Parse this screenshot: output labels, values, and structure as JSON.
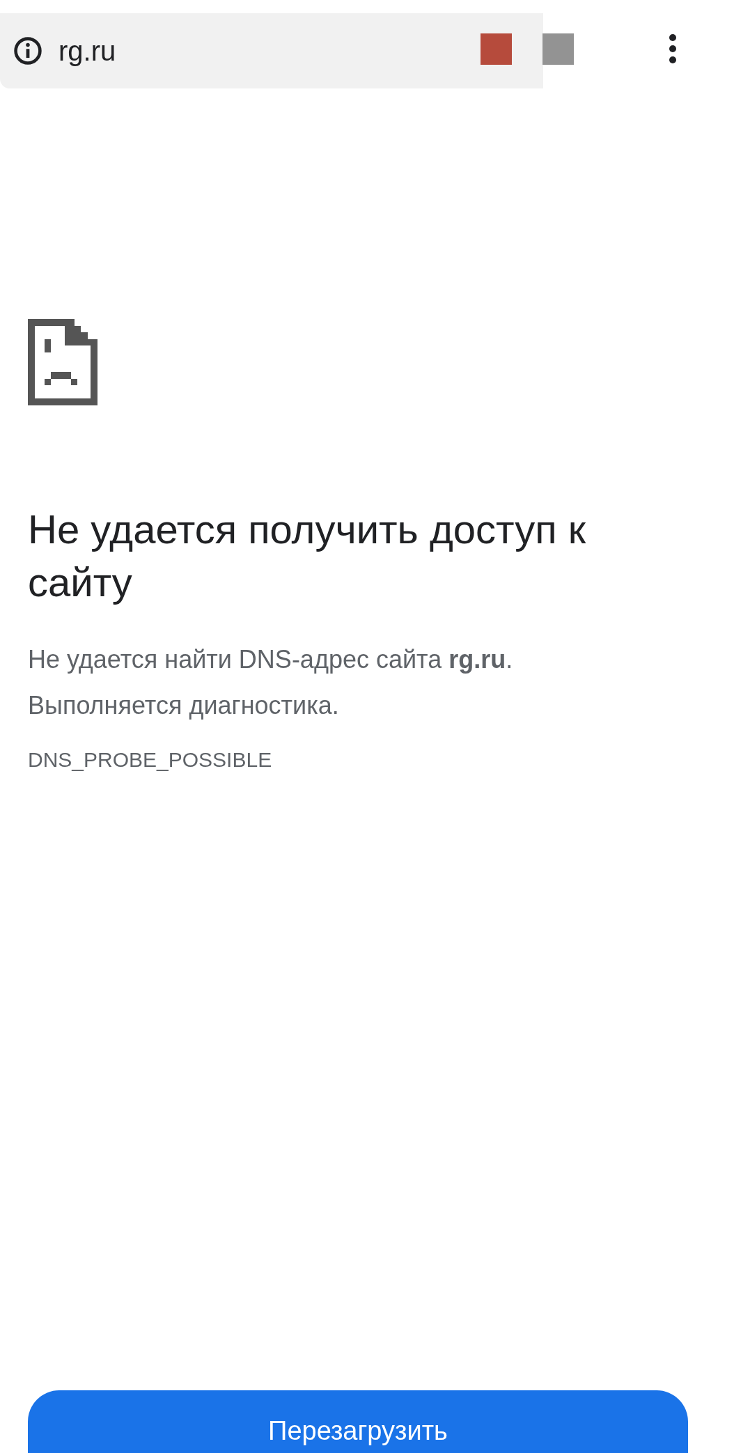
{
  "address_bar": {
    "url": "rg.ru"
  },
  "error": {
    "title": "Не удается получить доступ к сайту",
    "message": "Не удается найти DNS-адрес сайта **rg.ru**.",
    "detail": "Выполняется диагностика.",
    "code": "DNS_PROBE_POSSIBLE"
  },
  "buttons": [
    {
      "label": "Перезагрузить",
      "kind": "primary"
    }
  ]
}
